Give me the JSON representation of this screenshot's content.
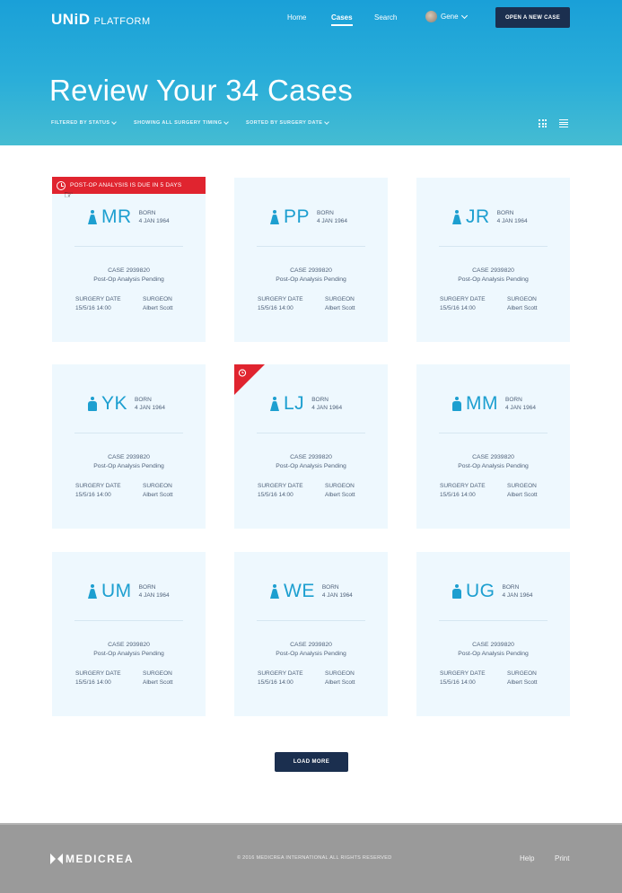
{
  "header": {
    "logo": "UNiD",
    "logo_sub": "PLATFORM",
    "nav": [
      {
        "label": "Home",
        "active": false
      },
      {
        "label": "Cases",
        "active": true
      },
      {
        "label": "Search",
        "active": false
      }
    ],
    "user": {
      "name": "Gene"
    },
    "open_case_button": "OPEN A NEW CASE"
  },
  "page": {
    "title": "Review Your 34 Cases",
    "filters": [
      "FILTERED BY STATUS",
      "SHOWING ALL SURGERY TIMING",
      "SORTED BY SURGERY DATE"
    ],
    "view_modes": [
      "grid-icon",
      "list-icon"
    ]
  },
  "cards": [
    {
      "initials": "MR",
      "born_label": "BORN",
      "born_date": "4 JAN 1964",
      "case": "CASE 2939820",
      "status": "Post-Op Analysis Pending",
      "surgery_date_label": "SURGERY DATE",
      "surgery_date": "15/5/16 14:00",
      "surgeon_label": "SURGEON",
      "surgeon": "Albert Scott",
      "alert": "POST-OP ANALYSIS IS DUE IN 5 DAYS",
      "gender": "female"
    },
    {
      "initials": "PP",
      "born_label": "BORN",
      "born_date": "4 JAN 1964",
      "case": "CASE 2939820",
      "status": "Post-Op Analysis Pending",
      "surgery_date_label": "SURGERY DATE",
      "surgery_date": "15/5/16 14:00",
      "surgeon_label": "SURGEON",
      "surgeon": "Albert Scott",
      "gender": "female"
    },
    {
      "initials": "JR",
      "born_label": "BORN",
      "born_date": "4 JAN 1964",
      "case": "CASE 2939820",
      "status": "Post-Op Analysis Pending",
      "surgery_date_label": "SURGERY DATE",
      "surgery_date": "15/5/16 14:00",
      "surgeon_label": "SURGEON",
      "surgeon": "Albert Scott",
      "gender": "female"
    },
    {
      "initials": "YK",
      "born_label": "BORN",
      "born_date": "4 JAN 1964",
      "case": "CASE 2939820",
      "status": "Post-Op Analysis Pending",
      "surgery_date_label": "SURGERY DATE",
      "surgery_date": "15/5/16 14:00",
      "surgeon_label": "SURGEON",
      "surgeon": "Albert Scott",
      "gender": "male"
    },
    {
      "initials": "LJ",
      "born_label": "BORN",
      "born_date": "4 JAN 1964",
      "case": "CASE 2939820",
      "status": "Post-Op Analysis Pending",
      "surgery_date_label": "SURGERY DATE",
      "surgery_date": "15/5/16 14:00",
      "surgeon_label": "SURGEON",
      "surgeon": "Albert Scott",
      "corner_alert": true,
      "gender": "female"
    },
    {
      "initials": "MM",
      "born_label": "BORN",
      "born_date": "4 JAN 1964",
      "case": "CASE 2939820",
      "status": "Post-Op Analysis Pending",
      "surgery_date_label": "SURGERY DATE",
      "surgery_date": "15/5/16 14:00",
      "surgeon_label": "SURGEON",
      "surgeon": "Albert Scott",
      "gender": "male"
    },
    {
      "initials": "UM",
      "born_label": "BORN",
      "born_date": "4 JAN 1964",
      "case": "CASE 2939820",
      "status": "Post-Op Analysis Pending",
      "surgery_date_label": "SURGERY DATE",
      "surgery_date": "15/5/16 14:00",
      "surgeon_label": "SURGEON",
      "surgeon": "Albert Scott",
      "gender": "female"
    },
    {
      "initials": "WE",
      "born_label": "BORN",
      "born_date": "4 JAN 1964",
      "case": "CASE 2939820",
      "status": "Post-Op Analysis Pending",
      "surgery_date_label": "SURGERY DATE",
      "surgery_date": "15/5/16 14:00",
      "surgeon_label": "SURGEON",
      "surgeon": "Albert Scott",
      "gender": "female"
    },
    {
      "initials": "UG",
      "born_label": "BORN",
      "born_date": "4 JAN 1964",
      "case": "CASE 2939820",
      "status": "Post-Op Analysis Pending",
      "surgery_date_label": "SURGERY DATE",
      "surgery_date": "15/5/16 14:00",
      "surgeon_label": "SURGEON",
      "surgeon": "Albert Scott",
      "gender": "male"
    }
  ],
  "load_more": "LOAD MORE",
  "footer": {
    "logo": "MEDICREA",
    "copyright": "© 2016 MEDICREA INTERNATIONAL ALL RIGHTS RESERVED",
    "links": [
      "Help",
      "Print"
    ]
  },
  "colors": {
    "accent": "#1d9fd0",
    "navy": "#1b2f4f",
    "alert": "#e0242f",
    "card_bg": "#eef8fe",
    "footer_bg": "#9a9a9a"
  }
}
